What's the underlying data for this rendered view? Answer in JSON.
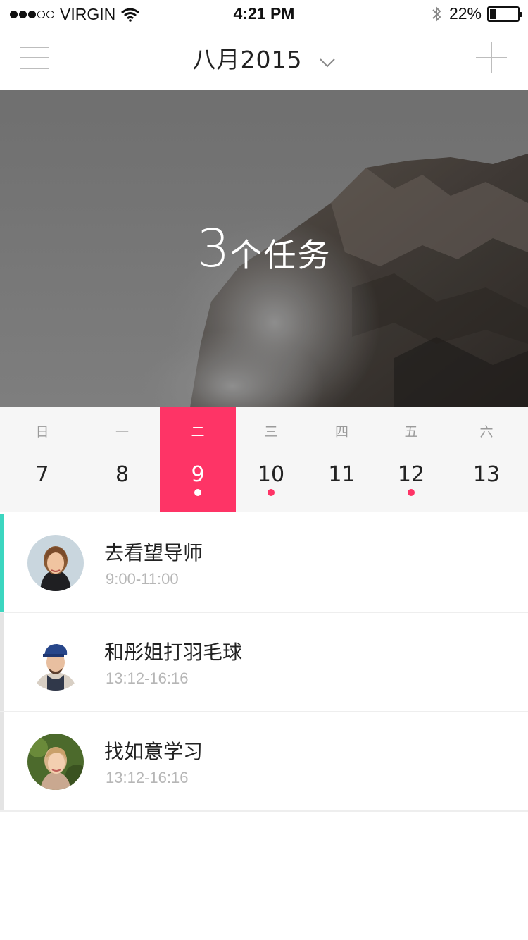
{
  "status_bar": {
    "carrier": "VIRGIN",
    "signal_bars_filled": 3,
    "signal_bars_total": 5,
    "time": "4:21 PM",
    "battery_percent_text": "22%",
    "battery_level": 0.22
  },
  "header": {
    "title": "八月2015",
    "menu_icon": "hamburger-menu-icon",
    "dropdown_icon": "chevron-down-icon",
    "add_icon": "plus-icon"
  },
  "hero": {
    "count": "3",
    "label": "个任务"
  },
  "week": {
    "days": [
      {
        "weekday": "日",
        "date": "7",
        "has_task": false,
        "selected": false
      },
      {
        "weekday": "一",
        "date": "8",
        "has_task": false,
        "selected": false
      },
      {
        "weekday": "二",
        "date": "9",
        "has_task": true,
        "selected": true
      },
      {
        "weekday": "三",
        "date": "10",
        "has_task": true,
        "selected": false
      },
      {
        "weekday": "四",
        "date": "11",
        "has_task": false,
        "selected": false
      },
      {
        "weekday": "五",
        "date": "12",
        "has_task": true,
        "selected": false
      },
      {
        "weekday": "六",
        "date": "13",
        "has_task": false,
        "selected": false
      }
    ]
  },
  "tasks": [
    {
      "title": "去看望导师",
      "time": "9:00-11:00",
      "active": true
    },
    {
      "title": "和彤姐打羽毛球",
      "time": "13:12-16:16",
      "active": false
    },
    {
      "title": "找如意学习",
      "time": "13:12-16:16",
      "active": false
    }
  ],
  "colors": {
    "accent": "#fe3466",
    "active_indicator": "#3cd6c0",
    "muted_text": "#b6b6b6"
  }
}
